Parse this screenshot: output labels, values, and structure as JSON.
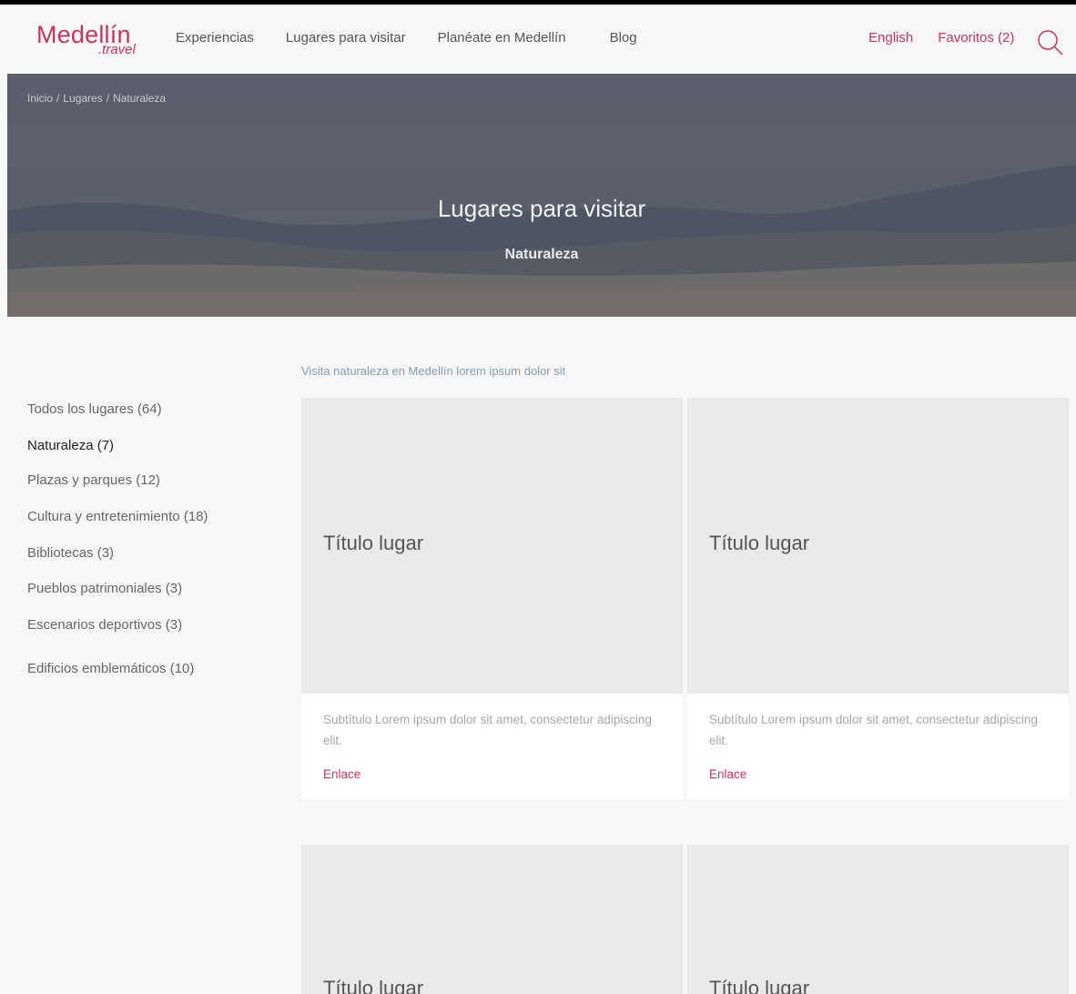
{
  "header": {
    "logo": {
      "main": "Medellín",
      "sub": ".travel"
    },
    "nav": [
      {
        "label": "Experiencias"
      },
      {
        "label": "Lugares para visitar"
      },
      {
        "label": "Planéate en Medellín"
      },
      {
        "label": "Blog"
      }
    ],
    "language": "English",
    "favorites": "Favoritos (2)",
    "search_icon": "search-icon"
  },
  "hero": {
    "breadcrumb": [
      "Inicio",
      "Lugares",
      "Naturaleza"
    ],
    "title": "Lugares para visitar",
    "subtitle": "Naturaleza"
  },
  "sidebar": {
    "items": [
      {
        "label": "Todos los lugares (64)",
        "active": false
      },
      {
        "label": "Naturaleza (7)",
        "active": true
      },
      {
        "label": "Plazas y parques (12)",
        "active": false
      },
      {
        "label": "Cultura y entretenimiento (18)",
        "active": false
      },
      {
        "label": "Bibliotecas (3)",
        "active": false
      },
      {
        "label": "Pueblos patrimoniales (3)",
        "active": false
      },
      {
        "label": "Escenarios deportivos (3)",
        "active": false
      },
      {
        "label": "Edificios emblemáticos (10)",
        "active": false
      }
    ]
  },
  "main": {
    "intro": "Visita naturaleza en Medellín lorem ipsum dolor sit",
    "cards": [
      {
        "title": "Título lugar",
        "subtitle": "Subtítulo Lorem ipsum dolor sit amet, consectetur adipiscing elit.",
        "link": "Enlace"
      },
      {
        "title": "Título lugar",
        "subtitle": "Subtítulo Lorem ipsum dolor sit amet, consectetur adipiscing elit.",
        "link": "Enlace"
      },
      {
        "title": "Título lugar"
      },
      {
        "title": "Título lugar"
      }
    ]
  },
  "colors": {
    "accent": "#c7365a",
    "background": "#f7f7f7",
    "card_image": "#e9e9e9"
  }
}
